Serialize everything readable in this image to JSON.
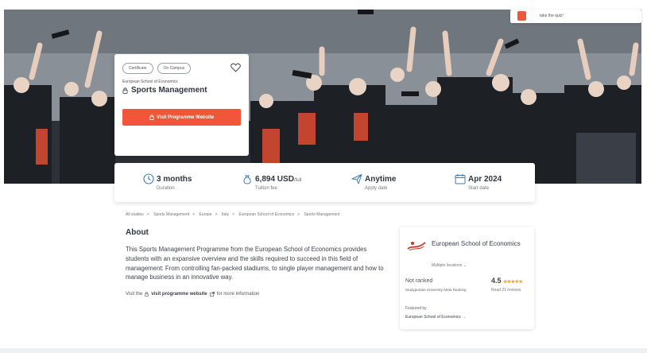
{
  "quiz_banner": {
    "text": "take the quiz!"
  },
  "card": {
    "tags": [
      "Certificate",
      "On Campus"
    ],
    "school": "European School of Economics",
    "title": "Sports Management",
    "visit_button": "Visit Programme Website"
  },
  "stats": [
    {
      "value": "3 months",
      "unit": "",
      "label": "Duration",
      "icon": "clock-icon"
    },
    {
      "value": "6,894 USD",
      "unit": "/full",
      "label": "Tuition fee",
      "icon": "money-bag-icon"
    },
    {
      "value": "Anytime",
      "unit": "",
      "label": "Apply date",
      "icon": "paper-plane-icon"
    },
    {
      "value": "Apr 2024",
      "unit": "",
      "label": "Start date",
      "icon": "calendar-icon"
    }
  ],
  "breadcrumb": [
    "All studies",
    "Sports Management",
    "Europe",
    "Italy",
    "European School of Economics",
    "Sports Management"
  ],
  "about": {
    "heading": "About",
    "text": "This Sports Management Programme from the European School of Economics provides students with an expansive overview and the skills required to succeed in this field of management: From controlling fan-packed stadiums, to single player management and how to manage business in an innovative way.",
    "visit_prefix": "Visit the",
    "visit_link": "visit programme website",
    "visit_suffix": "for more information"
  },
  "university": {
    "name": "European School of Economics",
    "locations": "Multiple locations",
    "rank": "Not ranked",
    "rank_source": "Studyportals University Meta Ranking",
    "rating": "4.5",
    "stars": "★★★★★",
    "reviews": "Read 21 reviews",
    "featured_label": "Featured by",
    "featured_name": "European School of Economics"
  },
  "colors": {
    "accent": "#f2563a",
    "star": "#f3a712",
    "text_dark": "#2f3640"
  }
}
